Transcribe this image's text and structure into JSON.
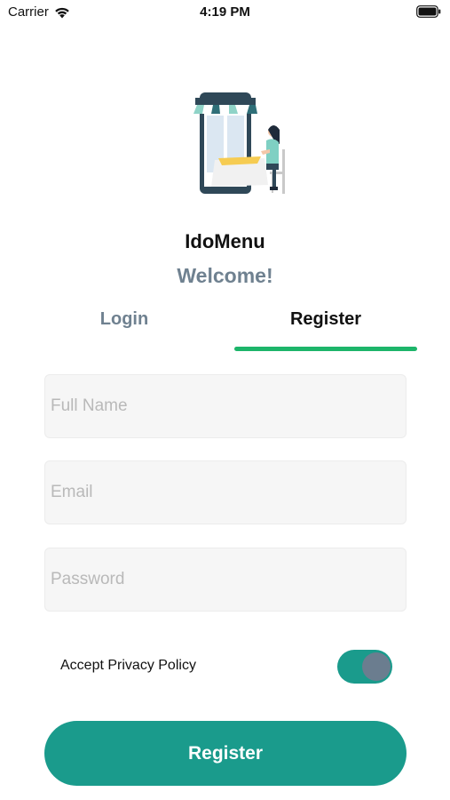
{
  "status_bar": {
    "carrier": "Carrier",
    "time": "4:19 PM"
  },
  "app": {
    "title": "IdoMenu",
    "welcome": "Welcome!"
  },
  "tabs": [
    {
      "label": "Login",
      "active": false
    },
    {
      "label": "Register",
      "active": true
    }
  ],
  "form": {
    "full_name": {
      "placeholder": "Full Name",
      "value": ""
    },
    "email": {
      "placeholder": "Email",
      "value": ""
    },
    "password": {
      "placeholder": "Password",
      "value": ""
    },
    "privacy": {
      "label": "Accept Privacy Policy",
      "enabled": true
    },
    "submit_label": "Register"
  },
  "colors": {
    "accent": "#1a9b8c",
    "tab_indicator": "#1db56a",
    "muted_text": "#6f8190",
    "field_bg": "#f6f6f6"
  },
  "icons": [
    "wifi-icon",
    "battery-icon",
    "storefront-illustration"
  ]
}
